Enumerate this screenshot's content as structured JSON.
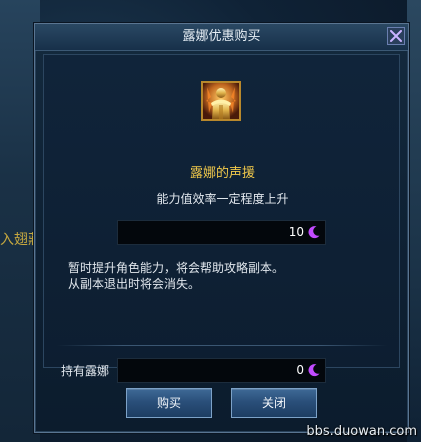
{
  "background": {
    "left_text": "入翅莊"
  },
  "dialog": {
    "title": "露娜优惠购买",
    "close_icon": "close-x-icon"
  },
  "item": {
    "icon": "golden-warrior-portrait",
    "name": "露娜的声援",
    "description": "能力值效率一定程度上升",
    "price": "10",
    "currency_icon": "crescent-moon-icon",
    "effect_line1": "暂时提升角色能力，将会帮助攻略副本。",
    "effect_line2": "从副本退出时将会消失。"
  },
  "owned": {
    "label": "持有露娜",
    "value": "0"
  },
  "buttons": {
    "buy": "购买",
    "close": "关闭"
  },
  "watermark": "bbs.duowan.com",
  "colors": {
    "item_name": "#f0c84a",
    "moon": "#c24bff",
    "panel": "#0e2134",
    "button": "#2a4f7a"
  }
}
